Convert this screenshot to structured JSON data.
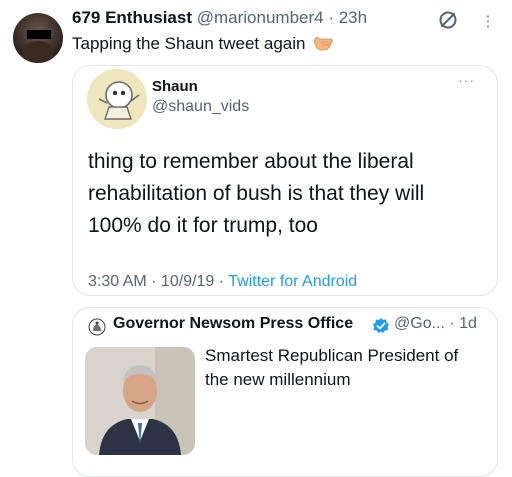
{
  "tweet": {
    "display_name": "679 Enthusiast",
    "handle": "@marionumber4",
    "time": " · 23h",
    "text": "Tapping the Shaun tweet again",
    "emoji": "backhand-index-pointing-left"
  },
  "quoted": {
    "display_name": "Shaun",
    "handle": "@shaun_vids",
    "lines": [
      "thing to remember about the liberal",
      "rehabilitation of bush is that they will",
      "100% do it for trump, too"
    ],
    "time": "3:30 AM",
    "date": "10/9/19",
    "sep": " · ",
    "source": "Twitter for Android"
  },
  "quoted2": {
    "display_name": "Governor Newsom Press Office",
    "handle": "@Go...",
    "time": " · 1d",
    "lines": [
      "Smartest Republican President of",
      "the new millennium"
    ]
  },
  "colors": {
    "link": "#1d9bf0",
    "muted": "#536471",
    "border": "#e1e6ea",
    "verified": "#1d9bf0"
  }
}
